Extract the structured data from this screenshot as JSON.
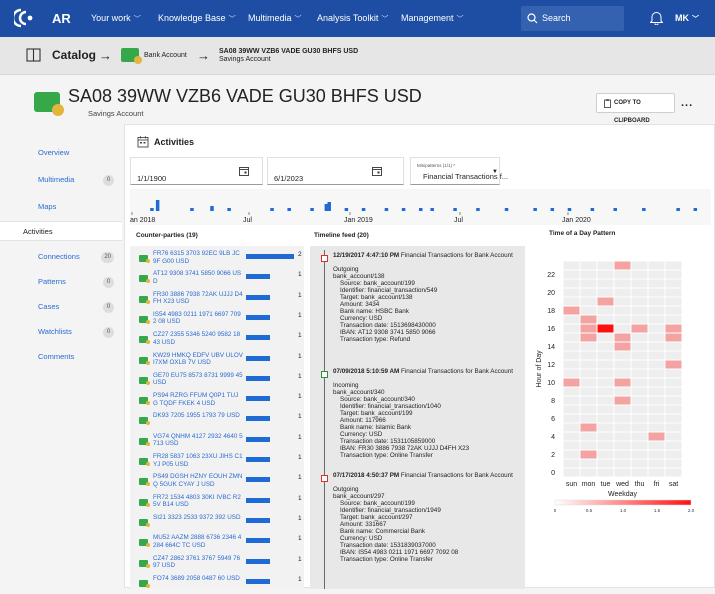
{
  "topnav": {
    "brand": "AR",
    "menus": [
      "Your work",
      "Knowledge Base",
      "Multimedia",
      "Analysis Toolkit",
      "Management"
    ],
    "search_placeholder": "Search",
    "user_initials": "MK"
  },
  "breadcrumb": {
    "catalog": "Catalog",
    "arrow": "→",
    "account_label": "Bank Account",
    "entity_title": "SA08 39WW VZB6 VADE GU30 BHFS USD",
    "entity_subtitle": "Savings Account"
  },
  "header": {
    "title": "SA08 39WW VZB6 VADE GU30 BHFS USD",
    "type": "Savings Account",
    "copy_button": "COPY TO CLIPBOARD",
    "more": "..."
  },
  "sidenav": [
    {
      "label": "Overview",
      "count": ""
    },
    {
      "label": "Multimedia",
      "count": "0"
    },
    {
      "label": "Maps",
      "count": ""
    },
    {
      "label": "Activities",
      "count": "",
      "active": true
    },
    {
      "label": "Connections",
      "count": "20"
    },
    {
      "label": "Patterns",
      "count": "0"
    },
    {
      "label": "Cases",
      "count": "0"
    },
    {
      "label": "Watchlists",
      "count": "0"
    },
    {
      "label": "Comments",
      "count": ""
    }
  ],
  "activities": {
    "title": "Activities",
    "date_from": "1/1/1900",
    "date_to": "6/1/2023",
    "minipatterns_label": "Minipatterns (1/1) *",
    "minipatterns_value": "Financial Transactions f...",
    "timeline_labels": [
      "an 2018",
      "Jul",
      "Jan 2019",
      "Jul",
      "Jan 2020"
    ],
    "timeline_bars": [
      {
        "t": 0.03,
        "h": 3
      },
      {
        "t": 0.04,
        "h": 11
      },
      {
        "t": 0.1,
        "h": 3
      },
      {
        "t": 0.135,
        "h": 5
      },
      {
        "t": 0.165,
        "h": 3
      },
      {
        "t": 0.24,
        "h": 3
      },
      {
        "t": 0.27,
        "h": 3
      },
      {
        "t": 0.31,
        "h": 3
      },
      {
        "t": 0.335,
        "h": 7
      },
      {
        "t": 0.34,
        "h": 9
      },
      {
        "t": 0.37,
        "h": 3
      },
      {
        "t": 0.4,
        "h": 3
      },
      {
        "t": 0.44,
        "h": 3
      },
      {
        "t": 0.47,
        "h": 3
      },
      {
        "t": 0.5,
        "h": 3
      },
      {
        "t": 0.52,
        "h": 3
      },
      {
        "t": 0.56,
        "h": 3
      },
      {
        "t": 0.6,
        "h": 3
      },
      {
        "t": 0.65,
        "h": 3
      },
      {
        "t": 0.7,
        "h": 3
      },
      {
        "t": 0.73,
        "h": 3
      },
      {
        "t": 0.76,
        "h": 3
      },
      {
        "t": 0.8,
        "h": 3
      },
      {
        "t": 0.84,
        "h": 3
      },
      {
        "t": 0.89,
        "h": 3
      },
      {
        "t": 0.95,
        "h": 3
      },
      {
        "t": 0.98,
        "h": 3
      }
    ],
    "counterparties_title": "Counter-parties (19)",
    "counterparties": [
      {
        "name": "FR76 6315 3703 92EC 9LB JC9F G00 USD",
        "count": 2
      },
      {
        "name": "AT12 9308 3741 5850 9066 USD",
        "count": 1
      },
      {
        "name": "FR30 3886 7938 72AK UJJJ D4FH X23 USD",
        "count": 1
      },
      {
        "name": "IS54 4983 0211 1971 6697 7092 08 USD",
        "count": 1
      },
      {
        "name": "CZ27 2355 5346 5240 9582 1843 USD",
        "count": 1
      },
      {
        "name": "KW29 HMKQ EDFV UBV ULOV I7XM OXLB 7V USD",
        "count": 1
      },
      {
        "name": "GE70 EU75 8573 8731 9999 45 USD",
        "count": 1
      },
      {
        "name": "PS94 RZRG FFUM Q0P1 TUJG TQDF FKEK 4 USD",
        "count": 1
      },
      {
        "name": "DK93 7205 1955 1793 79 USD",
        "count": 1
      },
      {
        "name": "VG74 QNHM 4127 2932 4640 5713 USD",
        "count": 1
      },
      {
        "name": "FR28 5837 1063 23XU JIHS C1YJ P05 USD",
        "count": 1
      },
      {
        "name": "PS49 DGSH HZNY EOUH ZMNQ 5GUK CYAY J USD",
        "count": 1
      },
      {
        "name": "FR72 1534 4803 30KI IVBC R25V B14 USD",
        "count": 1
      },
      {
        "name": "SI21 3323 2533 9372 392 USD",
        "count": 1
      },
      {
        "name": "MU52 AAZM 2888 6736 2346 4284 664C TC USD",
        "count": 1
      },
      {
        "name": "CZ47 2862 3761 3767 5949 7697 USD",
        "count": 1
      },
      {
        "name": "FO74 3689 2058 0487 60 USD",
        "count": 1
      }
    ],
    "feed_title": "Timeline feed (20)",
    "feed": [
      {
        "color": "red",
        "datetime": "12/19/2017 4:47:10 PM",
        "title": "Financial Transactions for Bank Account",
        "lines": [
          "Outgoing",
          "bank_account/138"
        ],
        "details": [
          "Source: bank_account/199",
          "Identifier: financial_transaction/549",
          "Target: bank_account/138",
          "Amount: 3434",
          "Bank name: HSBC Bank",
          "Currency: USD",
          "Transaction date: 1513698430000",
          "IBAN: AT12 9308 3741 5850 9066",
          "Transaction type: Refund"
        ]
      },
      {
        "color": "green",
        "datetime": "07/09/2018 5:10:59 AM",
        "title": "Financial Transactions for Bank Account",
        "lines": [
          "Incoming",
          "bank_account/340"
        ],
        "details": [
          "Source: bank_account/340",
          "Identifier: financial_transaction/1040",
          "Target: bank_account/199",
          "Amount: 117966",
          "Bank name: Islamic Bank",
          "Currency: USD",
          "Transaction date: 1531105859000",
          "IBAN: FR30 3886 7938 72AK UJJJ D4FH X23",
          "Transaction type: Online Transfer"
        ]
      },
      {
        "color": "red",
        "datetime": "07/17/2018 4:50:37 PM",
        "title": "Financial Transactions for Bank Account",
        "lines": [
          "Outgoing",
          "bank_account/297"
        ],
        "details": [
          "Source: bank_account/199",
          "Identifier: financial_transaction/1949",
          "Target: bank_account/297",
          "Amount: 331667",
          "Bank name: Commercial Bank",
          "Currency: USD",
          "Transaction date: 1531839037000",
          "IBAN: IS54 4983 0211 1971 6697 7092 08",
          "Transaction type: Online Transfer"
        ]
      }
    ],
    "heatmap": {
      "title": "Time of a Day Pattern",
      "ylabel": "Hour of Day",
      "xlabel": "Weekday",
      "days": [
        "sun",
        "mon",
        "tue",
        "wed",
        "thu",
        "fri",
        "sat"
      ],
      "y_ticks": [
        0,
        2,
        4,
        6,
        8,
        10,
        12,
        14,
        16,
        18,
        20,
        22
      ],
      "cells": [
        {
          "day": 1,
          "hour": 2,
          "value": 1
        },
        {
          "day": 1,
          "hour": 5,
          "value": 1
        },
        {
          "day": 5,
          "hour": 4,
          "value": 1
        },
        {
          "day": 3,
          "hour": 8,
          "value": 1
        },
        {
          "day": 0,
          "hour": 10,
          "value": 1
        },
        {
          "day": 3,
          "hour": 10,
          "value": 1
        },
        {
          "day": 6,
          "hour": 12,
          "value": 1
        },
        {
          "day": 3,
          "hour": 14,
          "value": 1
        },
        {
          "day": 1,
          "hour": 15,
          "value": 1
        },
        {
          "day": 3,
          "hour": 15,
          "value": 1
        },
        {
          "day": 6,
          "hour": 15,
          "value": 1
        },
        {
          "day": 1,
          "hour": 16,
          "value": 1
        },
        {
          "day": 2,
          "hour": 16,
          "value": 2
        },
        {
          "day": 4,
          "hour": 16,
          "value": 1
        },
        {
          "day": 6,
          "hour": 16,
          "value": 1
        },
        {
          "day": 1,
          "hour": 17,
          "value": 1
        },
        {
          "day": 0,
          "hour": 18,
          "value": 1
        },
        {
          "day": 2,
          "hour": 19,
          "value": 1
        },
        {
          "day": 3,
          "hour": 23,
          "value": 1
        }
      ],
      "scale_ticks": [
        "0",
        "0.5",
        "1.0",
        "1.5",
        "2.0"
      ],
      "scale_max": 2
    }
  },
  "colors": {
    "nav_blue": "#1d4ea3",
    "link_blue": "#2b6bd0",
    "bar_blue": "#1f6bd6",
    "heat_low": "#f4a3a3",
    "heat_high": "#ff1010",
    "out_red": "#d8322e",
    "in_green": "#2e8f3e"
  }
}
